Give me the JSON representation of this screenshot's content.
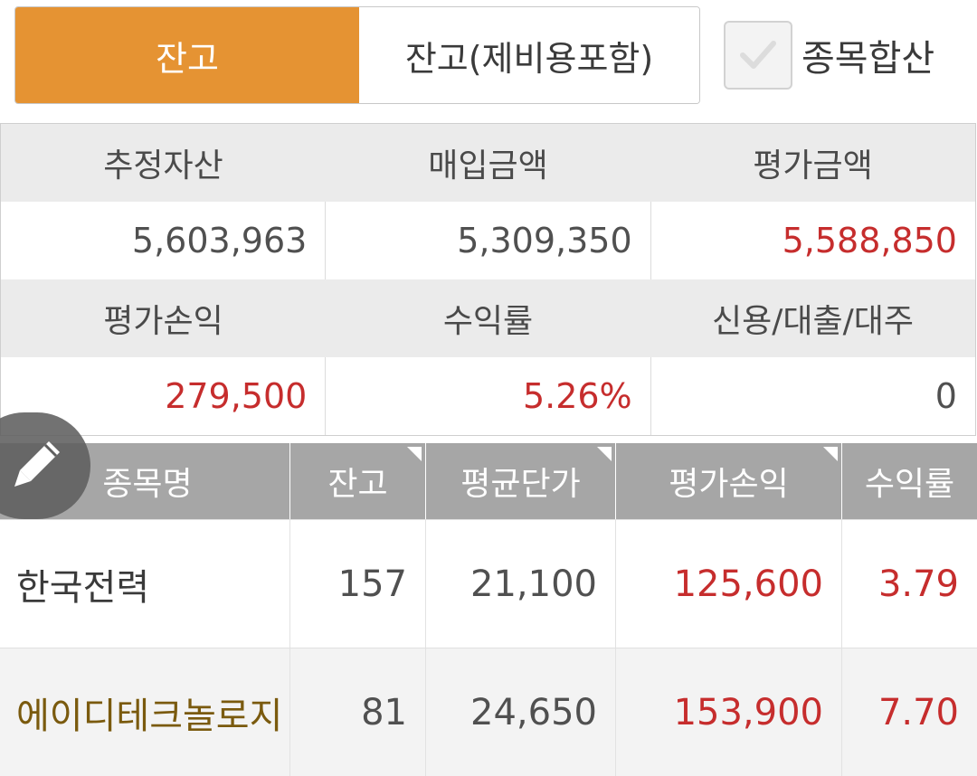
{
  "toggle": {
    "active_label": "잔고",
    "inactive_label": "잔고(제비용포함)"
  },
  "aggregate_checkbox": {
    "label": "종목합산",
    "checked": true
  },
  "summary": {
    "headers_row1": [
      "추정자산",
      "매입금액",
      "평가금액"
    ],
    "values_row1": [
      "5,603,963",
      "5,309,350",
      "5,588,850"
    ],
    "headers_row2": [
      "평가손익",
      "수익률",
      "신용/대출/대주"
    ],
    "values_row2": [
      "279,500",
      "5.26%",
      "0"
    ]
  },
  "holdings": {
    "columns": [
      "종목명",
      "잔고",
      "평균단가",
      "평가손익",
      "수익률"
    ],
    "rows": [
      {
        "name": "한국전력",
        "qty": "157",
        "avg_price": "21,100",
        "pnl": "125,600",
        "rate": "3.79"
      },
      {
        "name": "에이디테크놀로지",
        "qty": "81",
        "avg_price": "24,650",
        "pnl": "153,900",
        "rate": "7.70"
      }
    ]
  },
  "colors": {
    "accent": "#e59333",
    "positive": "#c62d2d",
    "header_gray": "#a6a6a6",
    "highlight_name": "#7a5a0e"
  },
  "icons": {
    "checkbox": "check-icon",
    "edit": "pencil-icon",
    "sort_marker": "sort-corner-icon"
  }
}
